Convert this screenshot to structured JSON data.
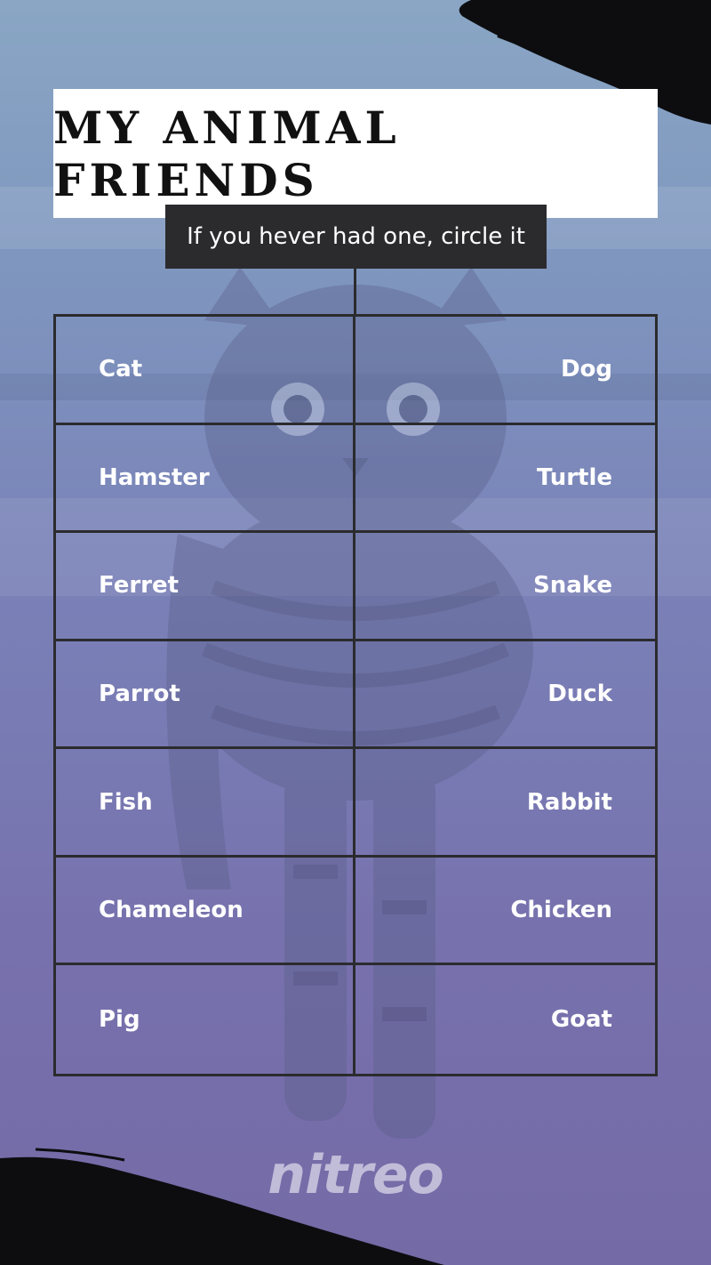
{
  "header": {
    "title": "MY ANIMAL FRIENDS",
    "subtitle": "If you hever had one, circle it"
  },
  "grid": {
    "rows": [
      {
        "left": "Cat",
        "right": "Dog"
      },
      {
        "left": "Hamster",
        "right": "Turtle"
      },
      {
        "left": "Ferret",
        "right": "Snake"
      },
      {
        "left": "Parrot",
        "right": "Duck"
      },
      {
        "left": "Fish",
        "right": "Rabbit"
      },
      {
        "left": "Chameleon",
        "right": "Chicken"
      },
      {
        "left": "Pig",
        "right": "Goat"
      }
    ]
  },
  "footer": {
    "logo": "nitreo"
  },
  "colors": {
    "background_top": "#8aa6c4",
    "background_bottom": "#746aa6",
    "card": "#ffffff",
    "dark": "#2b2b2e",
    "text_light": "#ffffff"
  }
}
